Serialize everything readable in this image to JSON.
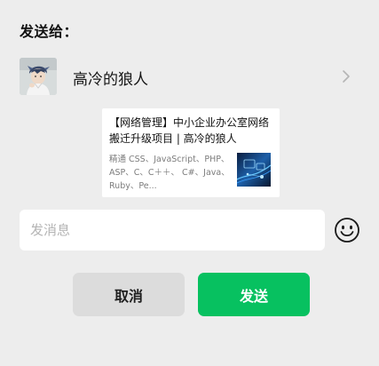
{
  "dialog": {
    "title": "发送给："
  },
  "recipient": {
    "name": "高冷的狼人",
    "avatar_icon": "user-avatar",
    "chevron_icon": "chevron-right-icon"
  },
  "shared_card": {
    "title": "【网络管理】中小企业办公室网络搬迁升级项目 | 高冷的狼人",
    "description": "精通 CSS、JavaScript、PHP、ASP、C、C＋＋、 C#、Java、Ruby、Pe...",
    "thumbnail_icon": "network-technology-thumbnail"
  },
  "message": {
    "placeholder": "发消息",
    "value": ""
  },
  "emoji": {
    "icon": "smiley-emoji-icon"
  },
  "actions": {
    "cancel_label": "取消",
    "send_label": "发送"
  },
  "colors": {
    "background": "#ededed",
    "send_button": "#07c160",
    "cancel_button": "#dcdcdc"
  }
}
